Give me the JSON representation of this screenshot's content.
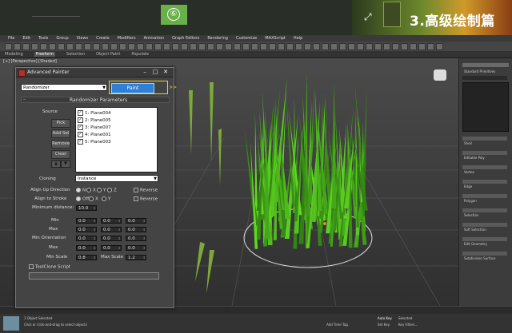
{
  "banner": {
    "title": "3.高级绘制篇"
  },
  "menubar": [
    "File",
    "Edit",
    "Tools",
    "Group",
    "Views",
    "Create",
    "Modifiers",
    "Animation",
    "Graph Editors",
    "Rendering",
    "Customize",
    "MAXScript",
    "Help"
  ],
  "ribbon": {
    "tabs": [
      "Modeling",
      "Freeform",
      "Selection",
      "Object Paint",
      "Populate"
    ]
  },
  "viewport": {
    "label": "[+] [Perspective] [Shaded]"
  },
  "dialog": {
    "title": "Advanced Painter",
    "mode": "Randomizer",
    "paint_button": "Paint",
    "marker": ">>",
    "step_badge": "⑥",
    "section_title": "Randomizer Parameters",
    "source_label": "Source",
    "buttons": {
      "pick": "Pick",
      "add_sel": "Add Sel",
      "remove": "Remove",
      "clear": "Clear"
    },
    "sources": [
      "1: Plane004",
      "2: Plane005",
      "3: Plane007",
      "4: Plane001",
      "5: Plane003"
    ],
    "cloning_label": "Cloning",
    "cloning_value": "Instance",
    "align_up_label": "Align Up Direction",
    "align_up_options": [
      "N",
      "X",
      "Y",
      "Z"
    ],
    "align_stroke_label": "Align to Stroke",
    "align_stroke_options": [
      "Off",
      "X",
      "Y"
    ],
    "reverse_label": "Reverse",
    "min_distance_label": "Minimum distance:",
    "min_distance_value": "10.0",
    "min_label": "Min",
    "max_label": "Max",
    "min_orientation_label": "Min Orientation",
    "min_scale_label": "Min Scale",
    "min_scale_value": "0.8",
    "max_scale_label": "Max Scale",
    "max_scale_value": "1.2",
    "zero": "0.0",
    "tool_clone_label": "ToolClone Script"
  },
  "status": {
    "line1": "1 Object Selected",
    "line2": "Click or click-and-drag to select objects",
    "addtime": "Add Time Tag",
    "auto_key": "Auto Key",
    "selected": "Selected",
    "set_key": "Set Key",
    "key_filters": "Key Filters..."
  },
  "sidebar": {
    "object_name": "Standard Primitives",
    "items": [
      "Shell",
      "Editable Poly",
      "Vertex",
      "Edge",
      "Polygon",
      "Selection",
      "Soft Selection",
      "Edit Geometry",
      "Subdivision Surface"
    ]
  }
}
